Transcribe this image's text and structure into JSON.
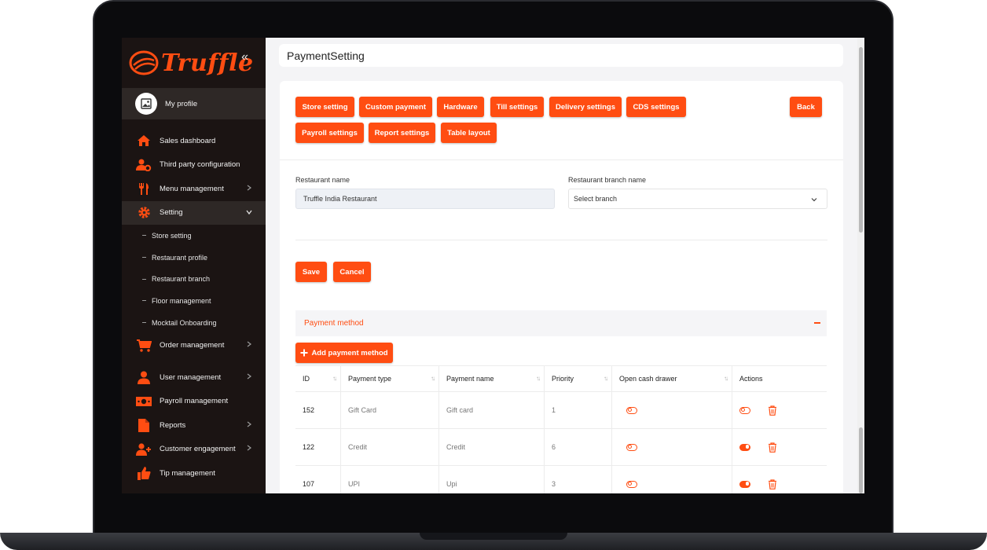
{
  "brand": {
    "name": "Truffle",
    "accent": "#ff4d12",
    "sidebar_bg": "#1b1413"
  },
  "sidebar": {
    "collapse_icon": "double-chevron-left-icon",
    "profile_label": "My profile",
    "items": [
      {
        "label": "Sales dashboard",
        "icon": "home-icon"
      },
      {
        "label": "Third party configuration",
        "icon": "user-gear-icon"
      },
      {
        "label": "Menu management",
        "icon": "fork-knife-icon",
        "has_children": true
      },
      {
        "label": "Setting",
        "icon": "gear-icon",
        "expanded": true
      },
      {
        "label": "Order management",
        "icon": "cart-icon",
        "has_children": true
      },
      {
        "label": "User management",
        "icon": "user-icon",
        "has_children": true
      },
      {
        "label": "Payroll management",
        "icon": "money-icon"
      },
      {
        "label": "Reports",
        "icon": "file-icon",
        "has_children": true
      },
      {
        "label": "Customer engagement",
        "icon": "user-plus-icon",
        "has_children": true
      },
      {
        "label": "Tip management",
        "icon": "thumbs-up-icon"
      }
    ],
    "setting_subitems": [
      "Store setting",
      "Restaurant profile",
      "Restaurant branch",
      "Floor management",
      "Mocktail Onboarding"
    ]
  },
  "page": {
    "title": "PaymentSetting"
  },
  "toolbar": {
    "tabs": [
      "Store setting",
      "Custom payment",
      "Hardware",
      "Till settings",
      "Delivery settings",
      "CDS settings",
      "Payroll settings",
      "Report settings",
      "Table layout"
    ],
    "back_label": "Back"
  },
  "form": {
    "restaurant_name_label": "Restaurant name",
    "restaurant_name_value": "Truffle India Restaurant",
    "branch_label": "Restaurant branch name",
    "branch_value": "Select branch",
    "save_label": "Save",
    "cancel_label": "Cancel"
  },
  "payment": {
    "section_title": "Payment method",
    "add_label": "Add payment method",
    "columns": [
      "ID",
      "Payment type",
      "Payment name",
      "Priority",
      "Open cash drawer",
      "Actions"
    ],
    "rows": [
      {
        "id": "152",
        "type": "Gift Card",
        "name": "Gift card",
        "priority": "1",
        "cash_drawer": false,
        "active": false
      },
      {
        "id": "122",
        "type": "Credit",
        "name": "Credit",
        "priority": "6",
        "cash_drawer": false,
        "active": true
      },
      {
        "id": "107",
        "type": "UPI",
        "name": "Upi",
        "priority": "3",
        "cash_drawer": false,
        "active": true
      }
    ]
  }
}
